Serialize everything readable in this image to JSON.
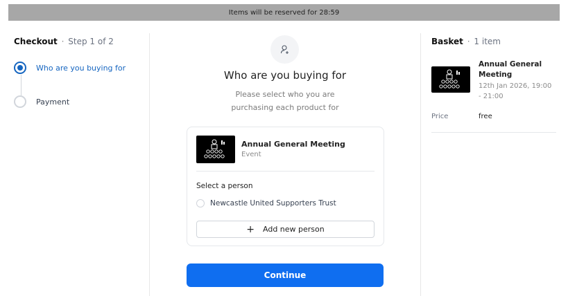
{
  "banner": {
    "text": "Items will be reserved for 28:59"
  },
  "checkout": {
    "title": "Checkout",
    "separator": "·",
    "step_text": "Step 1 of 2",
    "steps": [
      {
        "label": "Who are you buying for",
        "active": true
      },
      {
        "label": "Payment",
        "active": false
      }
    ]
  },
  "main": {
    "title": "Who are you buying for",
    "subtitle": "Please select who you are purchasing each product for",
    "product": {
      "title": "Annual General Meeting",
      "type": "Event"
    },
    "select_label": "Select a person",
    "people": [
      {
        "name": "Newcastle United Supporters Trust",
        "selected": false
      }
    ],
    "add_person_label": "Add new person",
    "continue_label": "Continue"
  },
  "basket": {
    "title": "Basket",
    "separator": "·",
    "count_text": "1 item",
    "item": {
      "name": "Annual General Meeting",
      "date": "12th Jan 2026, 19:00 - 21:00"
    },
    "price_label": "Price",
    "price_value": "free"
  },
  "colors": {
    "accent": "#0f6ef0",
    "step_active": "#1565c0",
    "banner_bg": "#a7a7a7"
  },
  "icons": {
    "person_add": "person-add-icon",
    "event": "meeting-audience-icon",
    "plus": "plus-icon"
  }
}
